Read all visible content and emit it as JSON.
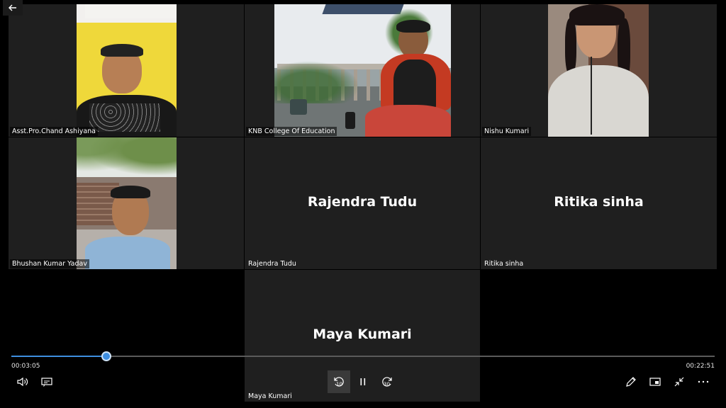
{
  "participants": [
    {
      "tag": "Asst.Pro.Chand Ashiyana"
    },
    {
      "tag": "KNB College Of Education"
    },
    {
      "tag": "Nishu Kumari"
    },
    {
      "tag": "Bhushan Kumar Yadav"
    },
    {
      "tag": "Rajendra Tudu",
      "big": "Rajendra Tudu"
    },
    {
      "tag": "Ritika sinha",
      "big": "Ritika sinha"
    },
    {
      "tag": "Maya Kumari",
      "big": "Maya Kumari"
    }
  ],
  "player": {
    "current_time": "00:03:05",
    "total_time": "00:22:51",
    "progress": 0.135,
    "rewind_seconds": "10",
    "forward_seconds": "30"
  },
  "colors": {
    "accent": "#3e8ee0",
    "tile_bg": "#1f1f1f",
    "background": "#000000"
  },
  "icons": [
    "back-arrow-icon",
    "volume-icon",
    "captions-icon",
    "rewind-10-icon",
    "pause-icon",
    "forward-30-icon",
    "pencil-icon",
    "miniplayer-icon",
    "exit-fullscreen-icon",
    "more-icon"
  ]
}
